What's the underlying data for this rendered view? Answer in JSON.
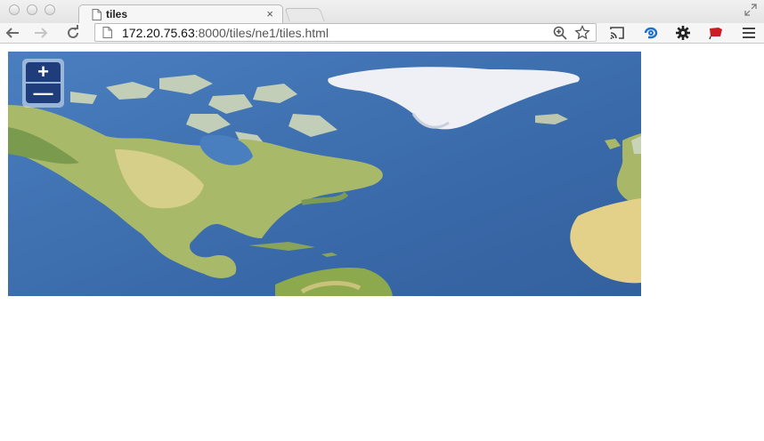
{
  "window": {
    "tab_title": "tiles",
    "tab_close": "×"
  },
  "toolbar": {
    "url_host": "172.20.75.63",
    "url_rest": ":8000/tiles/ne1/tiles.html"
  },
  "map": {
    "zoom_in_label": "+",
    "zoom_out_label": "—",
    "ocean_color": "#3d6fae",
    "control_color": "#1e3d7a"
  },
  "icons": [
    "page-icon",
    "back-arrow-icon",
    "forward-arrow-icon",
    "reload-icon",
    "zoom-icon",
    "star-icon",
    "cast-icon",
    "extension-icon",
    "gear-icon",
    "flag-icon",
    "menu-icon"
  ]
}
